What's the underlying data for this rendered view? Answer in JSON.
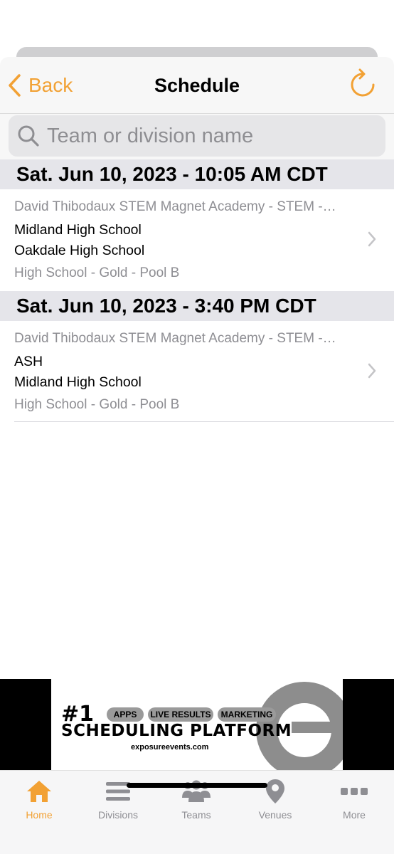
{
  "colors": {
    "accent": "#f2a134",
    "secondary_text": "#8e8e93"
  },
  "nav": {
    "back_label": "Back",
    "title": "Schedule"
  },
  "search": {
    "placeholder": "Team or division name"
  },
  "groups": [
    {
      "date": "Sat. Jun 10, 2023 - 10:05 AM CDT",
      "games": [
        {
          "venue": "David Thibodaux STEM Magnet Academy - STEM -…",
          "team1": "Midland High School",
          "team2": "Oakdale High School",
          "division": "High School - Gold - Pool B"
        }
      ]
    },
    {
      "date": "Sat. Jun 10, 2023 - 3:40 PM CDT",
      "games": [
        {
          "venue": "David Thibodaux STEM Magnet Academy - STEM -…",
          "team1": "ASH",
          "team2": "Midland High School",
          "division": "High School - Gold - Pool B"
        }
      ]
    }
  ],
  "ad": {
    "rank": "#1",
    "pills": [
      "APPS",
      "LIVE RESULTS",
      "MARKETING"
    ],
    "title": "SCHEDULING PLATFORM",
    "url": "exposureevents.com",
    "logo_icon": "exposure-e-logo"
  },
  "tabs": [
    {
      "label": "Home",
      "icon": "home-icon",
      "active": true
    },
    {
      "label": "Divisions",
      "icon": "list-icon",
      "active": false
    },
    {
      "label": "Teams",
      "icon": "teams-icon",
      "active": false
    },
    {
      "label": "Venues",
      "icon": "location-pin-icon",
      "active": false
    },
    {
      "label": "More",
      "icon": "more-dots-icon",
      "active": false
    }
  ]
}
